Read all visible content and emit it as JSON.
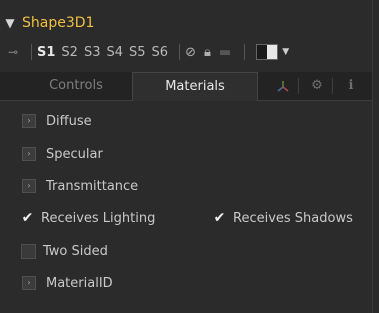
{
  "header": {
    "collapse_icon": "chevron-down-icon",
    "title": "Shape3D1"
  },
  "toolbar": {
    "pin_icon": "pin-icon",
    "slots": [
      "S1",
      "S2",
      "S3",
      "S4",
      "S5",
      "S6"
    ],
    "active_slot": "S1",
    "icons": [
      "disable-icon",
      "lock-icon",
      "reset-icon"
    ],
    "color_icon": "color-swatch-icon"
  },
  "tabs": {
    "controls": "Controls",
    "materials": "Materials",
    "active": "Materials",
    "icon_tabs": [
      "transform-axis-icon",
      "gear-icon",
      "info-icon"
    ]
  },
  "materials": {
    "sections": {
      "diffuse": "Diffuse",
      "specular": "Specular",
      "transmittance": "Transmittance",
      "material_id": "MaterialID"
    },
    "receives_lighting": {
      "label": "Receives Lighting",
      "checked": true
    },
    "receives_shadows": {
      "label": "Receives Shadows",
      "checked": true
    },
    "two_sided": {
      "label": "Two Sided",
      "checked": false
    }
  },
  "colors": {
    "title": "#f0c040",
    "background": "#2b2b2b"
  }
}
